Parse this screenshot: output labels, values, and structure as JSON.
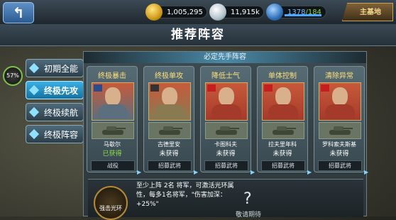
{
  "topbar": {
    "back_icon": "back-arrow-icon",
    "gold": "1,005,295",
    "silver": "11,915k",
    "energy_current": "1378",
    "energy_separator": "/",
    "energy_max": "184",
    "energy_fill": 1.0,
    "main_base_label": "主基地"
  },
  "title": "推荐阵容",
  "sidebar": {
    "percent": "57%",
    "items": [
      {
        "label": "初期全能",
        "active": false
      },
      {
        "label": "终极先攻",
        "active": true
      },
      {
        "label": "终极续航",
        "active": false
      },
      {
        "label": "终极阵容",
        "active": false
      }
    ]
  },
  "panel": {
    "title": "必定先手阵容",
    "cards": [
      {
        "category": "终极暴击",
        "general": "马歇尔",
        "status": "已获得",
        "button": "战役",
        "portrait_color": "#5c6f7e"
      },
      {
        "category": "终极单攻",
        "general": "古德里安",
        "status": "未获得",
        "button": "招募武将",
        "portrait_color": "#8a7a52"
      },
      {
        "category": "降低士气",
        "general": "卡图科夫",
        "status": "未获得",
        "button": "招募武将",
        "portrait_color": "#a43a2a"
      },
      {
        "category": "单体控制",
        "general": "拉夫里年科",
        "status": "未获得",
        "button": "招募武将",
        "portrait_color": "#a43a2a"
      },
      {
        "category": "清除异常",
        "general": "罗科索夫斯基",
        "status": "未获得",
        "button": "招募武将",
        "portrait_color": "#a43a2a"
      }
    ]
  },
  "aura": {
    "label": "强击光环",
    "description": "至少上阵 2名 将军，可激活光环属性，每多1名将军，\"伤害加深：+25%\"",
    "question": "?",
    "coming_soon": "敬请期待"
  },
  "colors": {
    "accent": "#2ea0dc",
    "gold_text": "#ffe07a",
    "ok_green": "#8ee04a"
  }
}
